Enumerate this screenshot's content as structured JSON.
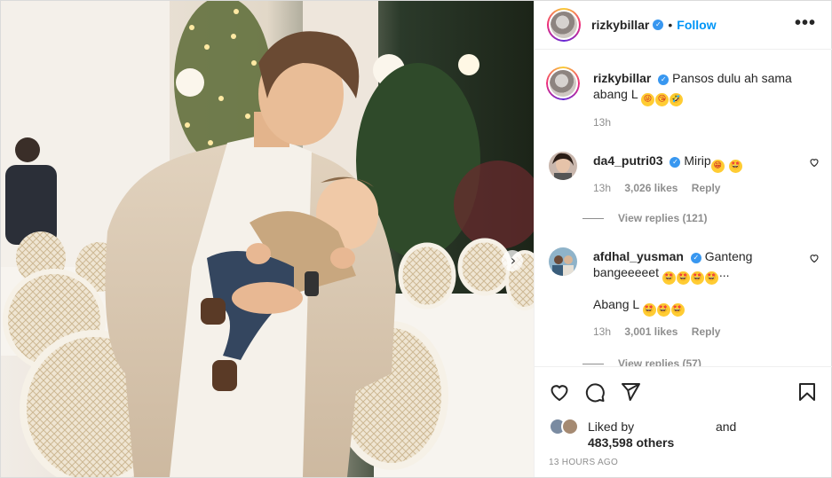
{
  "post": {
    "username": "rizkybillar",
    "follow_label": "Follow",
    "more_label": "•••",
    "verified_mark": "✓",
    "dot": "•"
  },
  "caption": {
    "username": "rizkybillar",
    "text": "Pansos dulu ah sama abang L",
    "emojis": [
      "😜",
      "😘",
      "🤣"
    ],
    "time": "13h"
  },
  "comments": [
    {
      "username": "da4_putri03",
      "text": "Mirip",
      "emojis": [
        "😁",
        "🤩"
      ],
      "time": "13h",
      "likes": "3,026 likes",
      "reply_label": "Reply",
      "view_replies": "View replies (121)"
    },
    {
      "username": "afdhal_yusman",
      "text": "Ganteng bangeeeeet",
      "emojis": [
        "🤩",
        "🤩",
        "🤩",
        "🤩"
      ],
      "suffix": "...",
      "text2": "Abang L",
      "emojis2": [
        "🤩",
        "🤩",
        "🤩"
      ],
      "time": "13h",
      "likes": "3,001 likes",
      "reply_label": "Reply",
      "view_replies": "View replies (57)"
    }
  ],
  "engagement": {
    "liked_by_prefix": "Liked by",
    "liked_by_and": "and",
    "others": "483,598 others",
    "timestamp": "13 HOURS AGO"
  },
  "icons": {
    "like": "heart-icon",
    "comment": "comment-icon",
    "share": "paper-plane-icon",
    "save": "bookmark-icon",
    "next": "chevron-right-icon"
  },
  "colors": {
    "follow": "#0095f6",
    "verified": "#3897f0",
    "meta_text": "#8e8e8e"
  }
}
